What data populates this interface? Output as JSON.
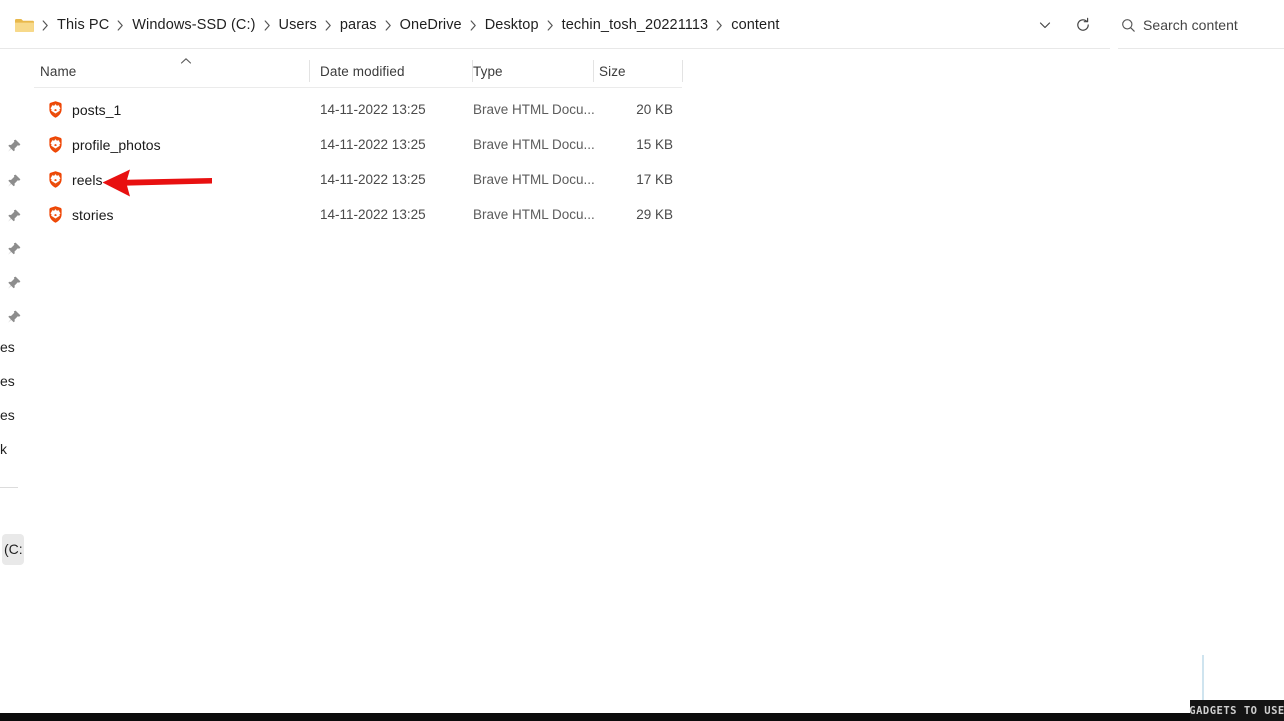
{
  "window": {
    "title": "content",
    "app": "File Explorer"
  },
  "address_bar": {
    "folder_icon": "folder-icon",
    "breadcrumb": [
      "This PC",
      "Windows-SSD (C:)",
      "Users",
      "paras",
      "OneDrive",
      "Desktop",
      "techin_tosh_20221113",
      "content"
    ],
    "separator": "›",
    "previous_locations_icon": "chevron-down-icon",
    "refresh_icon": "refresh-icon",
    "search": {
      "icon": "search-icon",
      "placeholder": "Search content",
      "value": ""
    }
  },
  "nav_pane": {
    "pin_icon": "pin-icon",
    "pinned_count": 6,
    "truncated_items": [
      "es",
      "es",
      "es",
      "k"
    ],
    "selected_item": "(C:"
  },
  "columns": {
    "name": "Name",
    "date_modified": "Date modified",
    "type": "Type",
    "size": "Size",
    "sort_icon": "chevron-up-icon",
    "sort_column": "Name",
    "sort_order": "ascending"
  },
  "files": [
    {
      "icon": "brave-html-document-icon",
      "name": "posts_1",
      "date_modified": "14-11-2022 13:25",
      "type": "Brave HTML Docu...",
      "size": "20 KB"
    },
    {
      "icon": "brave-html-document-icon",
      "name": "profile_photos",
      "date_modified": "14-11-2022 13:25",
      "type": "Brave HTML Docu...",
      "size": "15 KB"
    },
    {
      "icon": "brave-html-document-icon",
      "name": "reels",
      "date_modified": "14-11-2022 13:25",
      "type": "Brave HTML Docu...",
      "size": "17 KB"
    },
    {
      "icon": "brave-html-document-icon",
      "name": "stories",
      "date_modified": "14-11-2022 13:25",
      "type": "Brave HTML Docu...",
      "size": "29 KB"
    }
  ],
  "annotation": {
    "arrow_icon": "red-arrow-pointing-left",
    "color": "#e81010",
    "points_at": "reels"
  },
  "watermark": {
    "text": "GADGETS TO USE"
  },
  "colors": {
    "background": "#ffffff",
    "text_primary": "#1a1a1a",
    "text_secondary": "#4a4a4a",
    "divider": "#e8e8e8",
    "selection": "#e9e9e9",
    "brave_orange": "#f14200",
    "folder_yellow": "#f3ca5a",
    "annotation_red": "#e81010"
  }
}
